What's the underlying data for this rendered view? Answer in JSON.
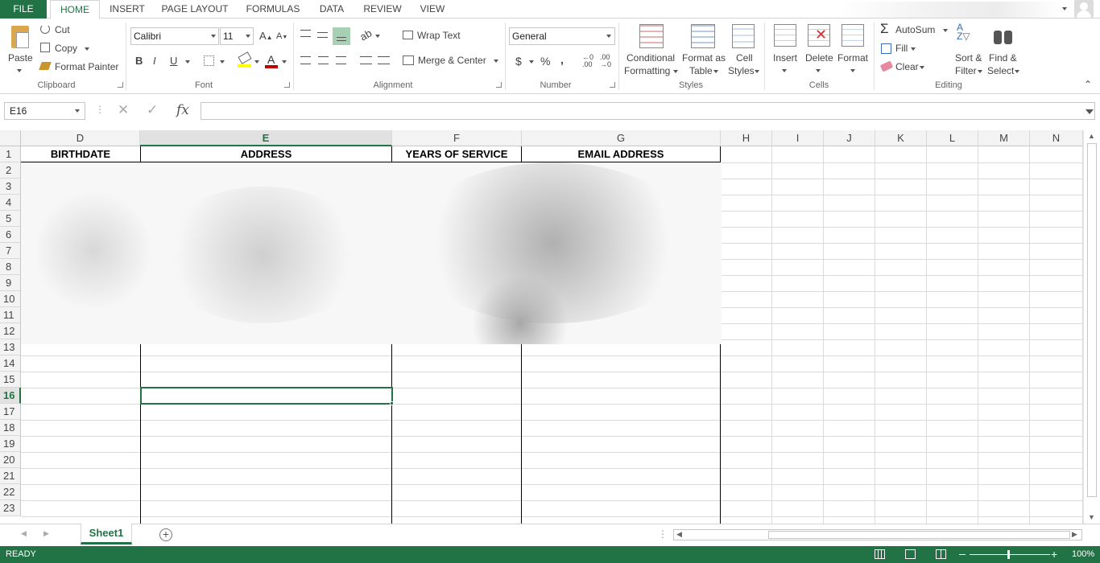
{
  "tabs": {
    "file": "FILE",
    "items": [
      "HOME",
      "INSERT",
      "PAGE LAYOUT",
      "FORMULAS",
      "DATA",
      "REVIEW",
      "VIEW"
    ]
  },
  "ribbon": {
    "clipboard": {
      "paste": "Paste",
      "cut": "Cut",
      "copy": "Copy",
      "format_painter": "Format Painter",
      "group": "Clipboard"
    },
    "font": {
      "name": "Calibri",
      "size": "11",
      "group": "Font",
      "bold": "B",
      "italic": "I",
      "underline": "U"
    },
    "alignment": {
      "wrap_text": "Wrap Text",
      "merge_center": "Merge & Center",
      "group": "Alignment"
    },
    "number": {
      "format": "General",
      "currency": "$",
      "percent": "%",
      "comma": ",",
      "group": "Number"
    },
    "styles": {
      "conditional_1": "Conditional",
      "conditional_2": "Formatting",
      "format_table_1": "Format as",
      "format_table_2": "Table",
      "cell_styles_1": "Cell",
      "cell_styles_2": "Styles",
      "group": "Styles"
    },
    "cells": {
      "insert": "Insert",
      "delete": "Delete",
      "format": "Format",
      "group": "Cells"
    },
    "editing": {
      "autosum": "AutoSum",
      "fill": "Fill",
      "clear": "Clear",
      "sort_1": "Sort &",
      "sort_2": "Filter",
      "find_1": "Find &",
      "find_2": "Select",
      "group": "Editing"
    }
  },
  "formula_bar": {
    "name_box": "E16",
    "fx": "fx",
    "value": ""
  },
  "grid": {
    "columns": [
      "D",
      "E",
      "F",
      "G",
      "H",
      "I",
      "J",
      "K",
      "L",
      "M",
      "N"
    ],
    "rows": [
      "1",
      "2",
      "3",
      "4",
      "5",
      "6",
      "7",
      "8",
      "9",
      "10",
      "11",
      "12",
      "13",
      "14",
      "15",
      "16",
      "17",
      "18",
      "19",
      "20",
      "21",
      "22",
      "23"
    ],
    "headers": {
      "D": "BIRTHDATE",
      "E": "ADDRESS",
      "F": "YEARS OF SERVICE",
      "G": "EMAIL ADDRESS"
    },
    "active_cell": "E16"
  },
  "sheets": {
    "active": "Sheet1"
  },
  "status": {
    "state": "READY",
    "zoom": "100%"
  },
  "colors": {
    "accent": "#217346",
    "active_header": "#217346"
  }
}
